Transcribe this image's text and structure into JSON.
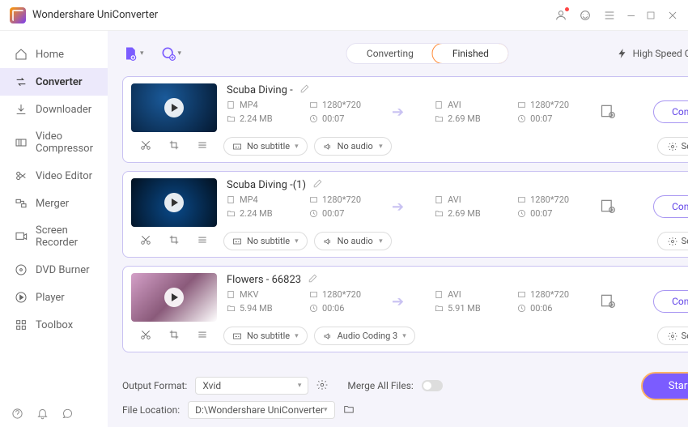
{
  "app": {
    "title": "Wondershare UniConverter"
  },
  "nav": [
    {
      "label": "Home"
    },
    {
      "label": "Converter"
    },
    {
      "label": "Downloader"
    },
    {
      "label": "Video Compressor"
    },
    {
      "label": "Video Editor"
    },
    {
      "label": "Merger"
    },
    {
      "label": "Screen Recorder"
    },
    {
      "label": "DVD Burner"
    },
    {
      "label": "Player"
    },
    {
      "label": "Toolbox"
    }
  ],
  "tabs": {
    "converting": "Converting",
    "finished": "Finished"
  },
  "speed_label": "High Speed Conversion",
  "items": [
    {
      "title": "Scuba Diving -",
      "src": {
        "fmt": "MP4",
        "res": "1280*720",
        "size": "2.24 MB",
        "dur": "00:07"
      },
      "dst": {
        "fmt": "AVI",
        "res": "1280*720",
        "size": "2.69 MB",
        "dur": "00:07"
      },
      "subtitle": "No subtitle",
      "audio": "No audio"
    },
    {
      "title": "Scuba Diving -(1)",
      "src": {
        "fmt": "MP4",
        "res": "1280*720",
        "size": "2.24 MB",
        "dur": "00:07"
      },
      "dst": {
        "fmt": "AVI",
        "res": "1280*720",
        "size": "2.69 MB",
        "dur": "00:07"
      },
      "subtitle": "No subtitle",
      "audio": "No audio"
    },
    {
      "title": "Flowers - 66823",
      "src": {
        "fmt": "MKV",
        "res": "1280*720",
        "size": "5.94 MB",
        "dur": "00:06"
      },
      "dst": {
        "fmt": "AVI",
        "res": "1280*720",
        "size": "5.91 MB",
        "dur": "00:06"
      },
      "subtitle": "No subtitle",
      "audio": "Audio Coding 3"
    }
  ],
  "btn": {
    "convert": "Convert",
    "settings": "Settings",
    "start_all": "Start All"
  },
  "footer": {
    "output_format_label": "Output Format:",
    "output_format_value": "Xvid",
    "merge_label": "Merge All Files:",
    "location_label": "File Location:",
    "location_value": "D:\\Wondershare UniConverter"
  }
}
